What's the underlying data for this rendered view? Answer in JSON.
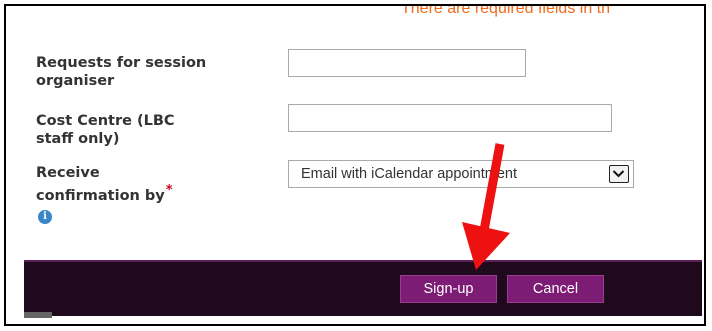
{
  "notice": {
    "text": "There are required fields in th"
  },
  "fields": [
    {
      "label_line1": "Requests for session",
      "label_line2": "organiser",
      "value": ""
    },
    {
      "label_line1": "Cost Centre (LBC",
      "label_line2": "staff only)",
      "value": ""
    }
  ],
  "confirmation": {
    "label_line1": "Receive",
    "label_line2": "confirmation by",
    "required_marker": "*",
    "selected": "Email with iCalendar appointment"
  },
  "buttons": {
    "signup_label": "Sign-up",
    "cancel_label": "Cancel"
  },
  "colors": {
    "accent": "#7c1c74",
    "footer": "#1e0a1c",
    "annotation_arrow": "#ee1111",
    "notice": "#f26a1b"
  },
  "icons": {
    "info": "info-icon",
    "dropdown": "chevron-down-icon",
    "annotation": "red-arrow-annotation"
  }
}
